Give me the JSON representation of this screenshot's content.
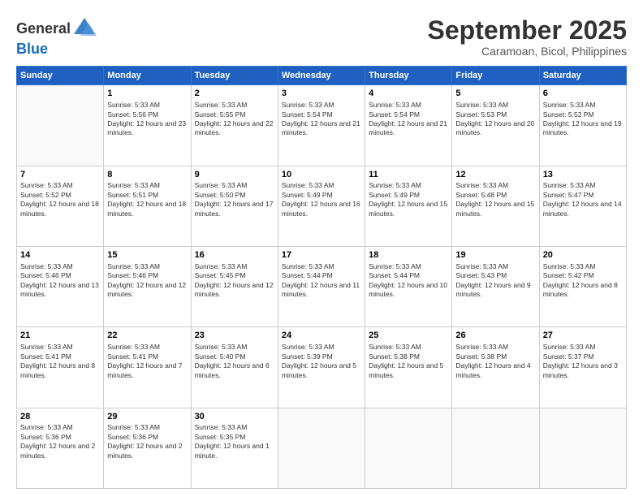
{
  "logo": {
    "general": "General",
    "blue": "Blue"
  },
  "title": "September 2025",
  "location": "Caramoan, Bicol, Philippines",
  "days_of_week": [
    "Sunday",
    "Monday",
    "Tuesday",
    "Wednesday",
    "Thursday",
    "Friday",
    "Saturday"
  ],
  "weeks": [
    [
      {
        "day": "",
        "content": ""
      },
      {
        "day": "1",
        "sunrise": "Sunrise: 5:33 AM",
        "sunset": "Sunset: 5:56 PM",
        "daylight": "Daylight: 12 hours and 23 minutes."
      },
      {
        "day": "2",
        "sunrise": "Sunrise: 5:33 AM",
        "sunset": "Sunset: 5:55 PM",
        "daylight": "Daylight: 12 hours and 22 minutes."
      },
      {
        "day": "3",
        "sunrise": "Sunrise: 5:33 AM",
        "sunset": "Sunset: 5:54 PM",
        "daylight": "Daylight: 12 hours and 21 minutes."
      },
      {
        "day": "4",
        "sunrise": "Sunrise: 5:33 AM",
        "sunset": "Sunset: 5:54 PM",
        "daylight": "Daylight: 12 hours and 21 minutes."
      },
      {
        "day": "5",
        "sunrise": "Sunrise: 5:33 AM",
        "sunset": "Sunset: 5:53 PM",
        "daylight": "Daylight: 12 hours and 20 minutes."
      },
      {
        "day": "6",
        "sunrise": "Sunrise: 5:33 AM",
        "sunset": "Sunset: 5:52 PM",
        "daylight": "Daylight: 12 hours and 19 minutes."
      }
    ],
    [
      {
        "day": "7",
        "sunrise": "Sunrise: 5:33 AM",
        "sunset": "Sunset: 5:52 PM",
        "daylight": "Daylight: 12 hours and 18 minutes."
      },
      {
        "day": "8",
        "sunrise": "Sunrise: 5:33 AM",
        "sunset": "Sunset: 5:51 PM",
        "daylight": "Daylight: 12 hours and 18 minutes."
      },
      {
        "day": "9",
        "sunrise": "Sunrise: 5:33 AM",
        "sunset": "Sunset: 5:50 PM",
        "daylight": "Daylight: 12 hours and 17 minutes."
      },
      {
        "day": "10",
        "sunrise": "Sunrise: 5:33 AM",
        "sunset": "Sunset: 5:49 PM",
        "daylight": "Daylight: 12 hours and 16 minutes."
      },
      {
        "day": "11",
        "sunrise": "Sunrise: 5:33 AM",
        "sunset": "Sunset: 5:49 PM",
        "daylight": "Daylight: 12 hours and 15 minutes."
      },
      {
        "day": "12",
        "sunrise": "Sunrise: 5:33 AM",
        "sunset": "Sunset: 5:48 PM",
        "daylight": "Daylight: 12 hours and 15 minutes."
      },
      {
        "day": "13",
        "sunrise": "Sunrise: 5:33 AM",
        "sunset": "Sunset: 5:47 PM",
        "daylight": "Daylight: 12 hours and 14 minutes."
      }
    ],
    [
      {
        "day": "14",
        "sunrise": "Sunrise: 5:33 AM",
        "sunset": "Sunset: 5:46 PM",
        "daylight": "Daylight: 12 hours and 13 minutes."
      },
      {
        "day": "15",
        "sunrise": "Sunrise: 5:33 AM",
        "sunset": "Sunset: 5:46 PM",
        "daylight": "Daylight: 12 hours and 12 minutes."
      },
      {
        "day": "16",
        "sunrise": "Sunrise: 5:33 AM",
        "sunset": "Sunset: 5:45 PM",
        "daylight": "Daylight: 12 hours and 12 minutes."
      },
      {
        "day": "17",
        "sunrise": "Sunrise: 5:33 AM",
        "sunset": "Sunset: 5:44 PM",
        "daylight": "Daylight: 12 hours and 11 minutes."
      },
      {
        "day": "18",
        "sunrise": "Sunrise: 5:33 AM",
        "sunset": "Sunset: 5:44 PM",
        "daylight": "Daylight: 12 hours and 10 minutes."
      },
      {
        "day": "19",
        "sunrise": "Sunrise: 5:33 AM",
        "sunset": "Sunset: 5:43 PM",
        "daylight": "Daylight: 12 hours and 9 minutes."
      },
      {
        "day": "20",
        "sunrise": "Sunrise: 5:33 AM",
        "sunset": "Sunset: 5:42 PM",
        "daylight": "Daylight: 12 hours and 8 minutes."
      }
    ],
    [
      {
        "day": "21",
        "sunrise": "Sunrise: 5:33 AM",
        "sunset": "Sunset: 5:41 PM",
        "daylight": "Daylight: 12 hours and 8 minutes."
      },
      {
        "day": "22",
        "sunrise": "Sunrise: 5:33 AM",
        "sunset": "Sunset: 5:41 PM",
        "daylight": "Daylight: 12 hours and 7 minutes."
      },
      {
        "day": "23",
        "sunrise": "Sunrise: 5:33 AM",
        "sunset": "Sunset: 5:40 PM",
        "daylight": "Daylight: 12 hours and 6 minutes."
      },
      {
        "day": "24",
        "sunrise": "Sunrise: 5:33 AM",
        "sunset": "Sunset: 5:39 PM",
        "daylight": "Daylight: 12 hours and 5 minutes."
      },
      {
        "day": "25",
        "sunrise": "Sunrise: 5:33 AM",
        "sunset": "Sunset: 5:38 PM",
        "daylight": "Daylight: 12 hours and 5 minutes."
      },
      {
        "day": "26",
        "sunrise": "Sunrise: 5:33 AM",
        "sunset": "Sunset: 5:38 PM",
        "daylight": "Daylight: 12 hours and 4 minutes."
      },
      {
        "day": "27",
        "sunrise": "Sunrise: 5:33 AM",
        "sunset": "Sunset: 5:37 PM",
        "daylight": "Daylight: 12 hours and 3 minutes."
      }
    ],
    [
      {
        "day": "28",
        "sunrise": "Sunrise: 5:33 AM",
        "sunset": "Sunset: 5:36 PM",
        "daylight": "Daylight: 12 hours and 2 minutes."
      },
      {
        "day": "29",
        "sunrise": "Sunrise: 5:33 AM",
        "sunset": "Sunset: 5:36 PM",
        "daylight": "Daylight: 12 hours and 2 minutes."
      },
      {
        "day": "30",
        "sunrise": "Sunrise: 5:33 AM",
        "sunset": "Sunset: 5:35 PM",
        "daylight": "Daylight: 12 hours and 1 minute."
      },
      {
        "day": "",
        "content": ""
      },
      {
        "day": "",
        "content": ""
      },
      {
        "day": "",
        "content": ""
      },
      {
        "day": "",
        "content": ""
      }
    ]
  ]
}
